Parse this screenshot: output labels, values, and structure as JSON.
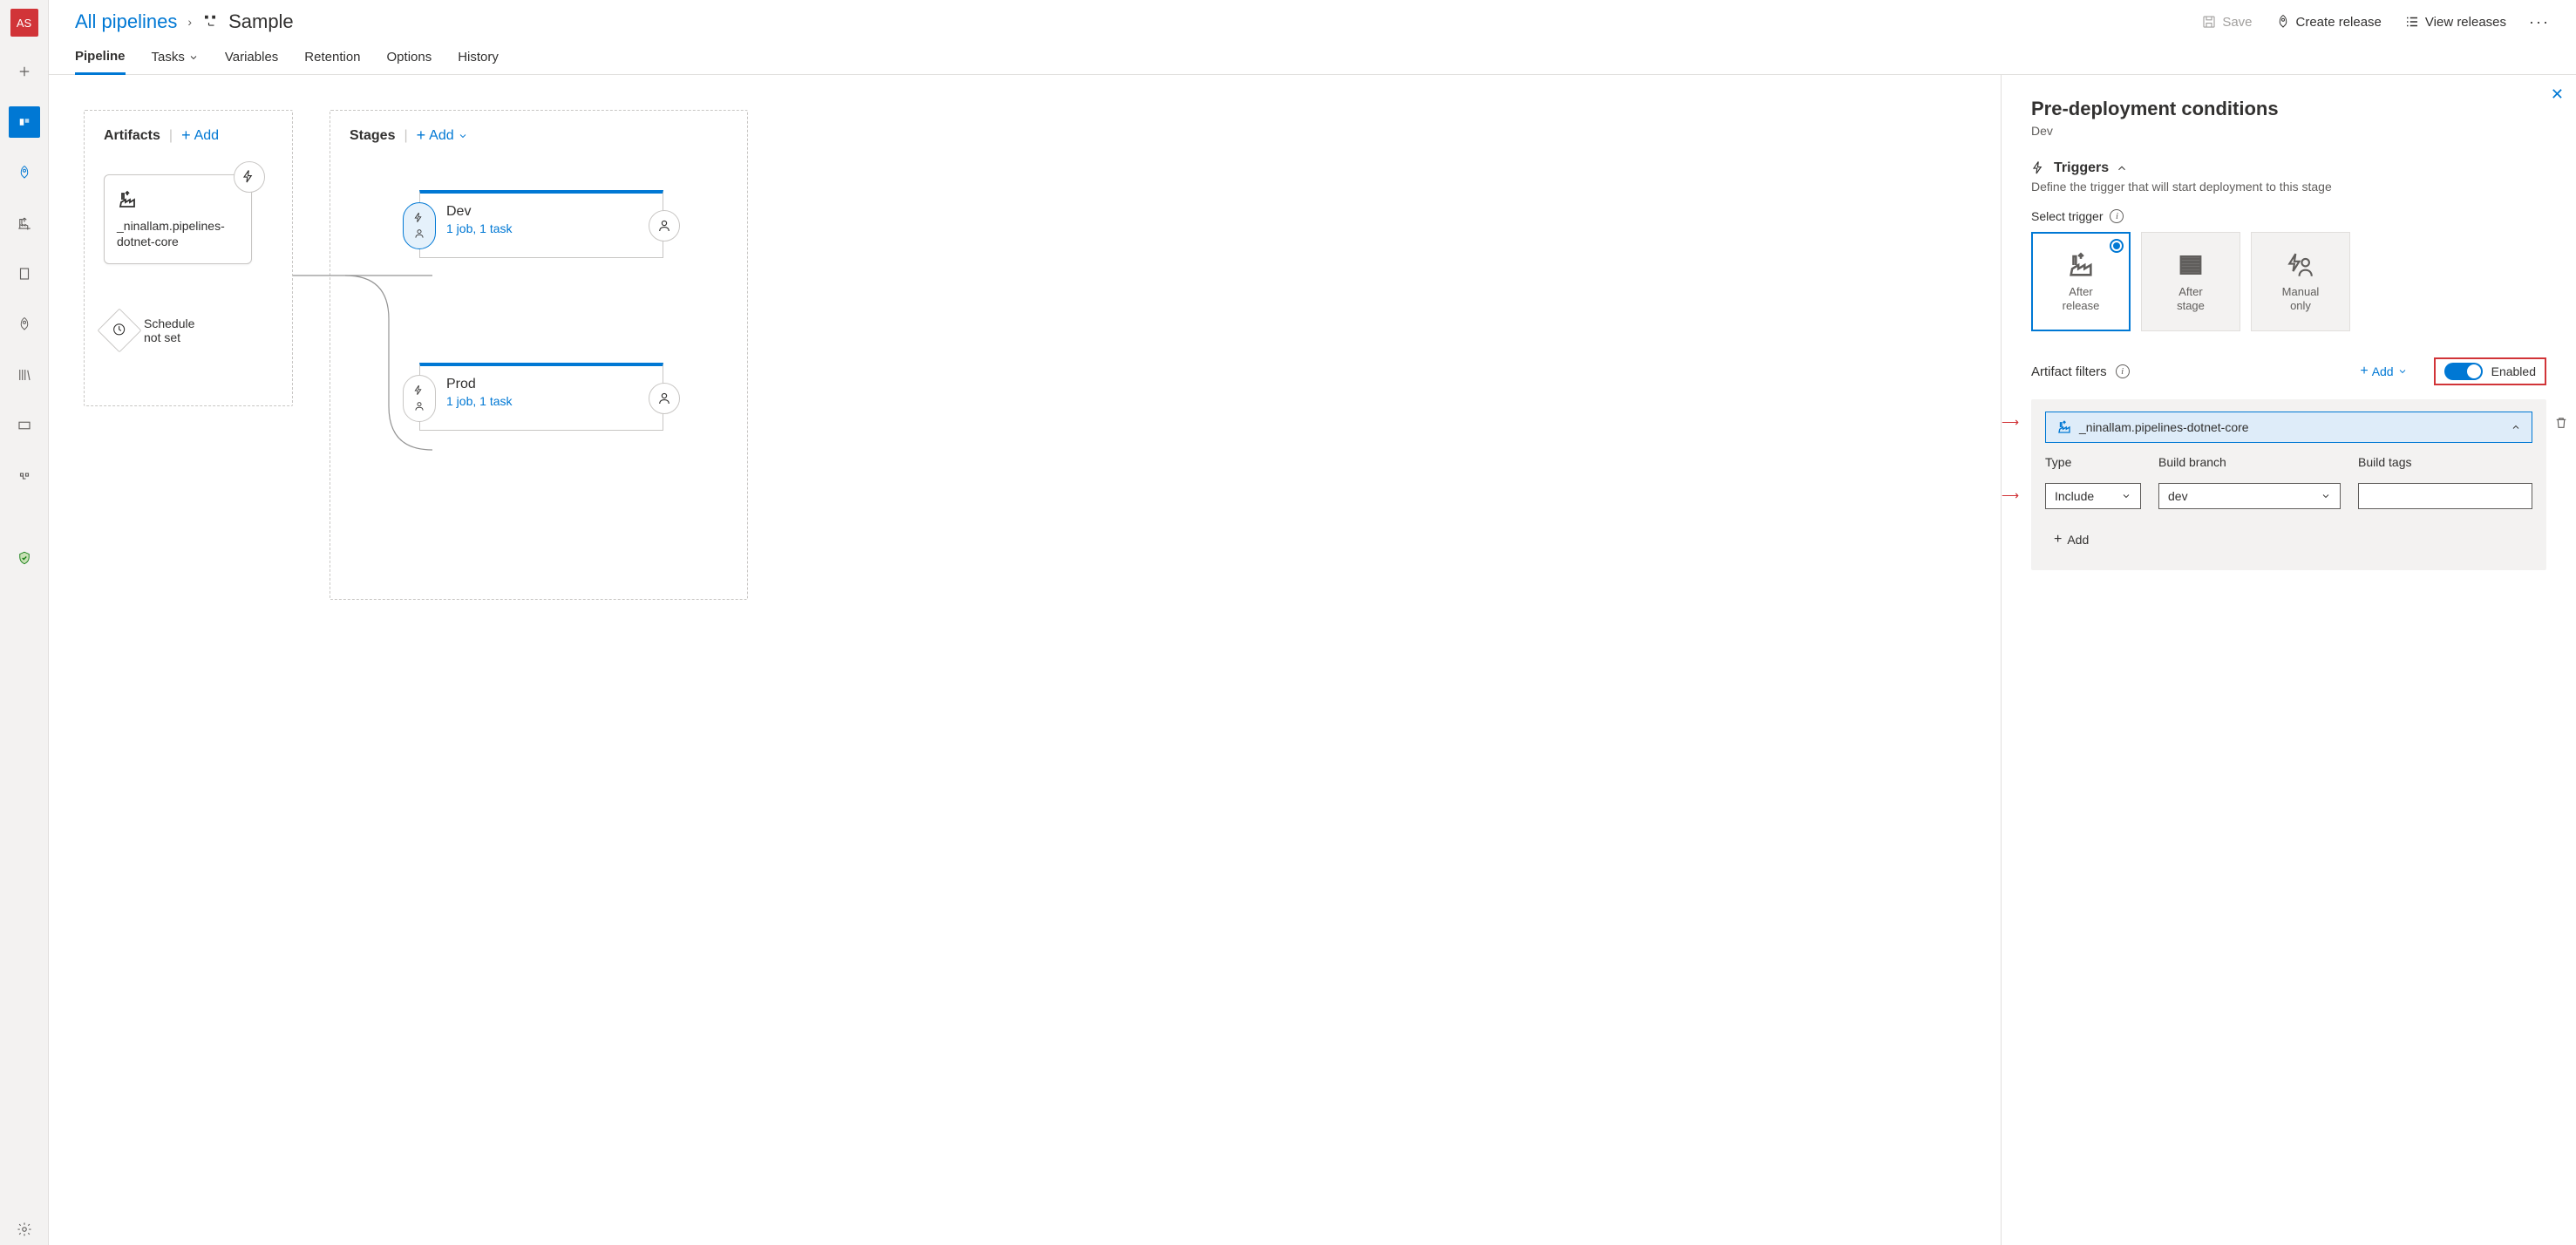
{
  "avatar": "AS",
  "breadcrumb": {
    "root": "All pipelines",
    "name": "Sample"
  },
  "header_actions": {
    "save": "Save",
    "create_release": "Create release",
    "view_releases": "View releases"
  },
  "tabs": {
    "pipeline": "Pipeline",
    "tasks": "Tasks",
    "variables": "Variables",
    "retention": "Retention",
    "options": "Options",
    "history": "History"
  },
  "canvas": {
    "artifacts_title": "Artifacts",
    "stages_title": "Stages",
    "add_label": "Add",
    "artifact_name": "_ninallam.pipelines-dotnet-core",
    "schedule_line1": "Schedule",
    "schedule_line2": "not set",
    "stage1": {
      "name": "Dev",
      "meta": "1 job, 1 task"
    },
    "stage2": {
      "name": "Prod",
      "meta": "1 job, 1 task"
    }
  },
  "panel": {
    "title": "Pre-deployment conditions",
    "stage": "Dev",
    "triggers_label": "Triggers",
    "triggers_desc": "Define the trigger that will start deployment to this stage",
    "select_trigger_label": "Select trigger",
    "options": {
      "after_release_l1": "After",
      "after_release_l2": "release",
      "after_stage_l1": "After",
      "after_stage_l2": "stage",
      "manual_l1": "Manual",
      "manual_l2": "only"
    },
    "artifact_filters_label": "Artifact filters",
    "add_label": "Add",
    "enabled_label": "Enabled",
    "filter_artifact_name": "_ninallam.pipelines-dotnet-core",
    "col_type": "Type",
    "col_branch": "Build branch",
    "col_tags": "Build tags",
    "type_value": "Include",
    "branch_value": "dev",
    "add_row_label": "Add"
  }
}
